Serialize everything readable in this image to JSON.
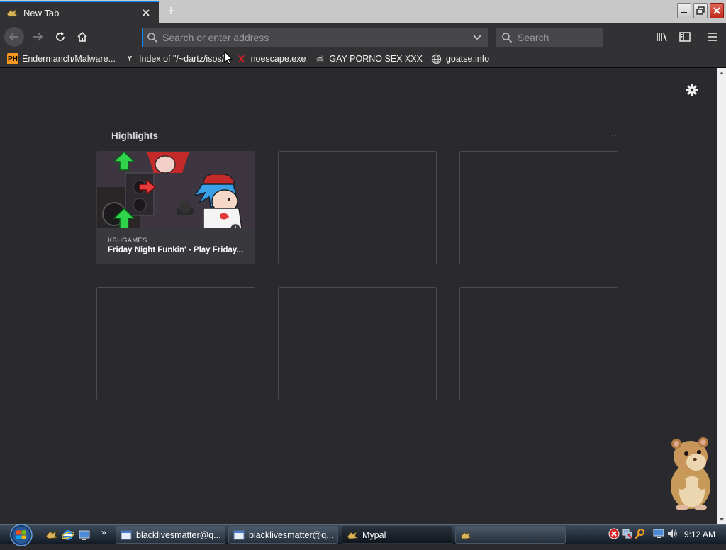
{
  "browser": {
    "tab": {
      "title": "New Tab",
      "close_label": "×"
    },
    "new_tab_label": "+",
    "url_placeholder": "Search or enter address",
    "search_placeholder": "Search"
  },
  "bookmarks": [
    {
      "label": "Endermanch/Malware...",
      "icon": "ph-icon",
      "badge": "PH",
      "color": "#f7971d"
    },
    {
      "label": "Index of \"/~dartz/isos/\"",
      "icon": "ycombinator-icon",
      "badge": "Y",
      "color": "#ff6600"
    },
    {
      "label": "noescape.exe",
      "icon": "red-x-icon",
      "badge": "X",
      "color": "#e02020"
    },
    {
      "label": "GAY PORNO SEX XXX",
      "icon": "skull-icon",
      "badge": "☠",
      "color": "#cfcfcf"
    },
    {
      "label": "goatse.info",
      "icon": "globe-icon",
      "badge": "",
      "color": "#cfcfcf"
    }
  ],
  "newtab": {
    "section_title": "Highlights",
    "more_dots": "···",
    "cards": [
      {
        "source": "KBHGAMES",
        "title": "Friday Night Funkin' - Play Friday..."
      }
    ]
  },
  "taskbar": {
    "buttons": [
      {
        "label": "blacklivesmatter@q...",
        "icon": "window-icon"
      },
      {
        "label": "blacklivesmatter@q...",
        "icon": "window-icon"
      },
      {
        "label": "Mypal",
        "icon": "mypal-icon"
      },
      {
        "label": "",
        "icon": "mypal-icon"
      }
    ],
    "overflow": "»",
    "clock": "9:12 AM"
  },
  "colors": {
    "accent": "#0a84ff",
    "toolbar": "#323234",
    "page_bg": "#2a2a2e"
  }
}
